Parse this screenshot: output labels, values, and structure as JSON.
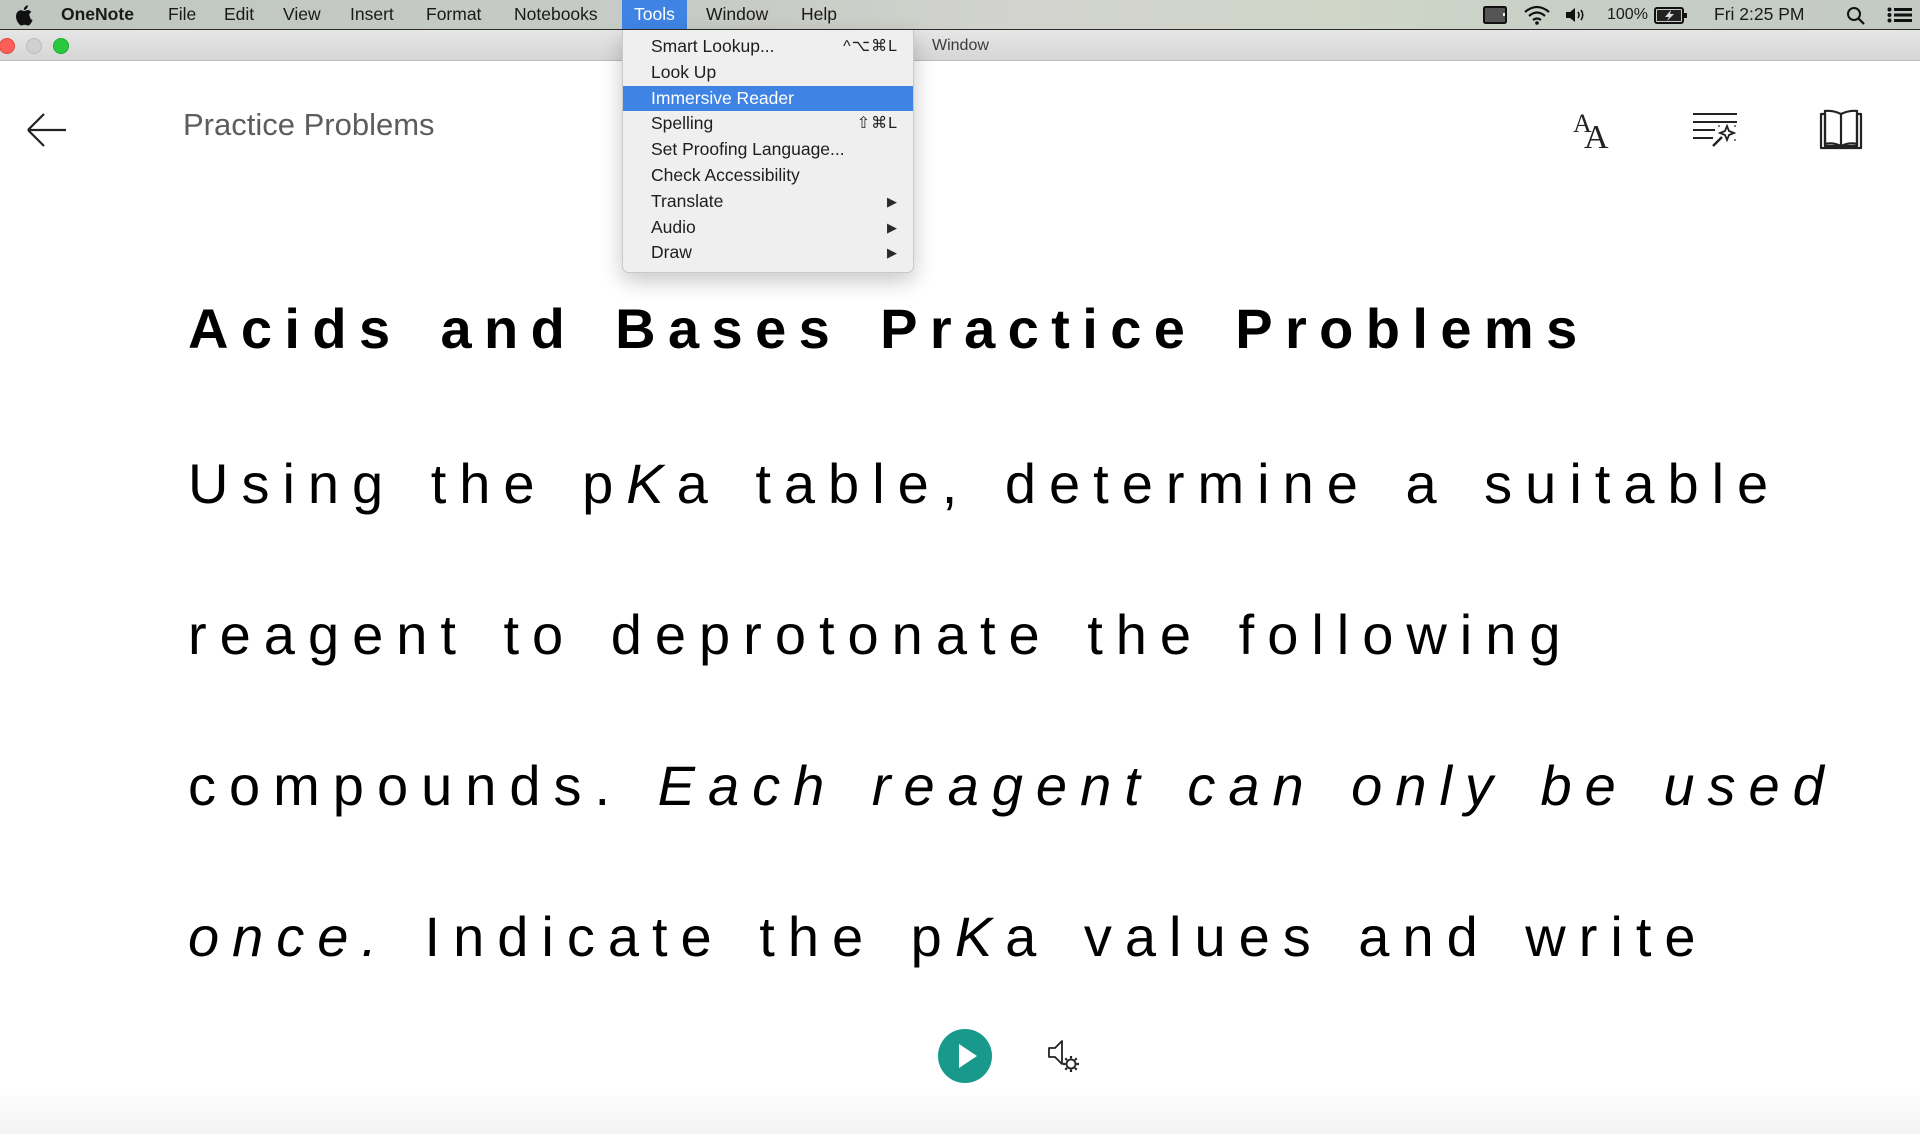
{
  "menubar": {
    "apple_icon": "apple-logo-icon",
    "app_name": "OneNote",
    "items": [
      "File",
      "Edit",
      "View",
      "Insert",
      "Format",
      "Notebooks",
      "Tools",
      "Window",
      "Help"
    ],
    "active_item": "Tools",
    "status": {
      "battery_percent": "100%",
      "clock": "Fri 2:25 PM",
      "icons": [
        "display-icon",
        "wifi-icon",
        "volume-icon",
        "battery-charging-icon",
        "spotlight-search-icon",
        "notification-center-icon"
      ]
    }
  },
  "window": {
    "title": "Window"
  },
  "tools_menu": {
    "items": [
      {
        "label": "Smart Lookup...",
        "shortcut": "^⌥⌘L",
        "submenu": false,
        "highlighted": false
      },
      {
        "label": "Look Up",
        "shortcut": "",
        "submenu": false,
        "highlighted": false
      },
      {
        "label": "Immersive Reader",
        "shortcut": "",
        "submenu": false,
        "highlighted": true
      },
      {
        "label": "Spelling",
        "shortcut": "⇧⌘L",
        "submenu": false,
        "highlighted": false
      },
      {
        "label": "Set Proofing Language...",
        "shortcut": "",
        "submenu": false,
        "highlighted": false
      },
      {
        "label": "Check Accessibility",
        "shortcut": "",
        "submenu": false,
        "highlighted": false
      },
      {
        "label": "Translate",
        "shortcut": "",
        "submenu": true,
        "highlighted": false
      },
      {
        "label": "Audio",
        "shortcut": "",
        "submenu": true,
        "highlighted": false
      },
      {
        "label": "Draw",
        "shortcut": "",
        "submenu": true,
        "highlighted": false
      }
    ],
    "submenu_arrow": "▶"
  },
  "reader": {
    "title": "Practice Problems",
    "toolbar": [
      "text-options-icon",
      "grammar-options-icon",
      "reading-preferences-icon"
    ],
    "heading": "Acids and Bases Practice Problems",
    "lines": [
      [
        {
          "t": "Using the p",
          "i": false
        },
        {
          "t": "K",
          "i": true
        },
        {
          "t": "a table, determine a suitable",
          "i": false
        }
      ],
      [
        {
          "t": "reagent to deprotonate the following",
          "i": false
        }
      ],
      [
        {
          "t": "compounds. ",
          "i": false
        },
        {
          "t": "Each reagent can only be used",
          "i": true
        }
      ],
      [
        {
          "t": "once.",
          "i": true
        },
        {
          "t": " Indicate the p",
          "i": false
        },
        {
          "t": "K",
          "i": true
        },
        {
          "t": "a values and write",
          "i": false
        }
      ]
    ],
    "playback": {
      "play_icon": "play-icon",
      "voice_settings_icon": "voice-settings-icon"
    }
  },
  "colors": {
    "menu_highlight": "#3f84e5",
    "play_button": "#18998b"
  }
}
